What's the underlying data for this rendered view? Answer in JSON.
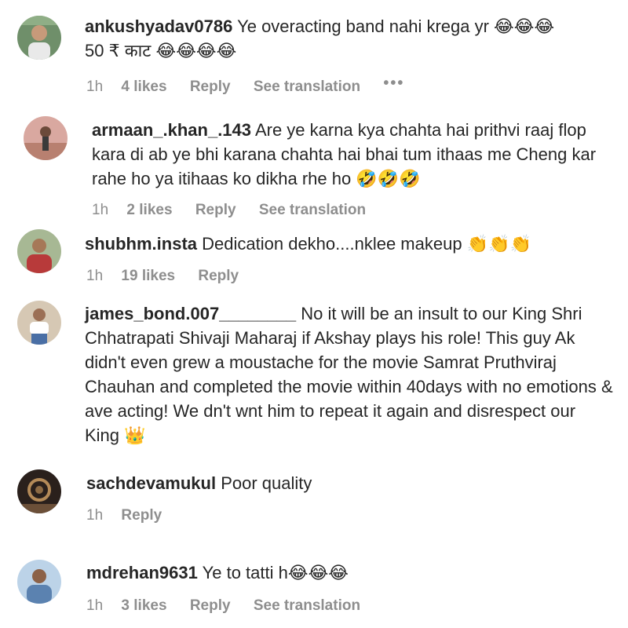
{
  "comments": [
    {
      "username": "ankushyadav0786",
      "text_lines": [
        "Ye overacting band nahi krega yr",
        "50 ₹ काट"
      ],
      "emojis_line1": "😂😂😂",
      "emojis_line2": "😂😂😂😂",
      "time": "1h",
      "likes": "4 likes",
      "reply": "Reply",
      "translate": "See translation",
      "more": "•••"
    },
    {
      "username": "armaan_.khan_.143",
      "text": "Are ye karna kya chahta hai prithvi raaj flop kara di ab ye bhi karana chahta hai bhai tum ithaas me Cheng kar rahe ho ya itihaas ko dikha rhe ho",
      "emojis": "🤣🤣🤣",
      "time": "1h",
      "likes": "2 likes",
      "reply": "Reply",
      "translate": "See translation"
    },
    {
      "username": "shubhm.insta",
      "text": "Dedication dekho....nklee makeup",
      "emojis": "👏👏👏",
      "time": "1h",
      "likes": "19 likes",
      "reply": "Reply"
    },
    {
      "username": "james_bond.007________",
      "text": "No it will be an insult to our King Shri Chhatrapati Shivaji Maharaj if Akshay plays his role! This guy Ak didn't even grew a moustache for the movie Samrat Pruthviraj Chauhan and completed the movie within 40days with no emotions & ave acting! We dn't wnt him to repeat it again and disrespect our King",
      "emojis": "👑"
    },
    {
      "username": "sachdevamukul",
      "text": "Poor quality",
      "time": "1h",
      "reply": "Reply"
    },
    {
      "username": "mdrehan9631",
      "text": "Ye to tatti h",
      "emojis": "😂😂😂",
      "time": "1h",
      "likes": "3 likes",
      "reply": "Reply",
      "translate": "See translation"
    }
  ],
  "colors": {
    "text": "#262626",
    "meta": "#8e8e8e",
    "background": "#ffffff"
  }
}
